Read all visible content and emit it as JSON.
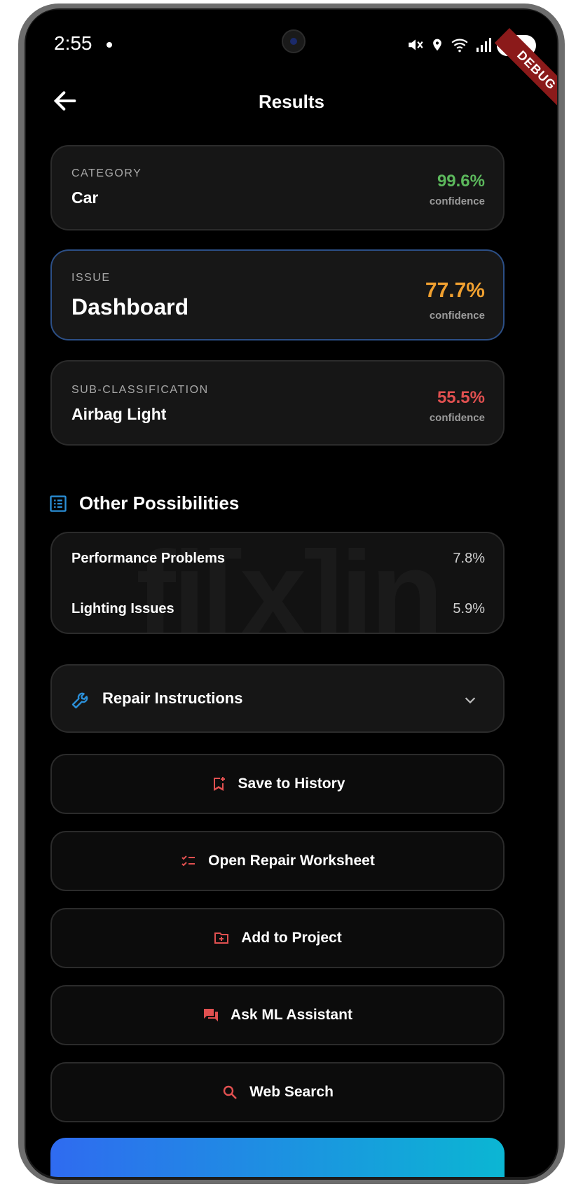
{
  "status_bar": {
    "time": "2:55",
    "battery": "58"
  },
  "debug_banner": "DEBUG",
  "app_bar": {
    "title": "Results"
  },
  "category": {
    "label": "CATEGORY",
    "value": "Car",
    "percent": "99.6%",
    "conf": "confidence",
    "color": "#5cb85c"
  },
  "issue": {
    "label": "ISSUE",
    "value": "Dashboard",
    "percent": "77.7%",
    "conf": "confidence",
    "color": "#f0a030"
  },
  "sub": {
    "label": "SUB-CLASSIFICATION",
    "value": "Airbag Light",
    "percent": "55.5%",
    "conf": "confidence",
    "color": "#e05050"
  },
  "other": {
    "title": "Other Possibilities",
    "watermark": "fi[x]in",
    "items": [
      {
        "label": "Performance Problems",
        "value": "7.8%"
      },
      {
        "label": "Lighting Issues",
        "value": "5.9%"
      }
    ]
  },
  "repair": {
    "label": "Repair Instructions"
  },
  "actions": {
    "save": "Save to History",
    "worksheet": "Open Repair Worksheet",
    "project": "Add to Project",
    "assistant": "Ask ML Assistant",
    "search": "Web Search"
  },
  "colors": {
    "accent_blue": "#2b8fd8",
    "accent_red": "#e05050"
  }
}
